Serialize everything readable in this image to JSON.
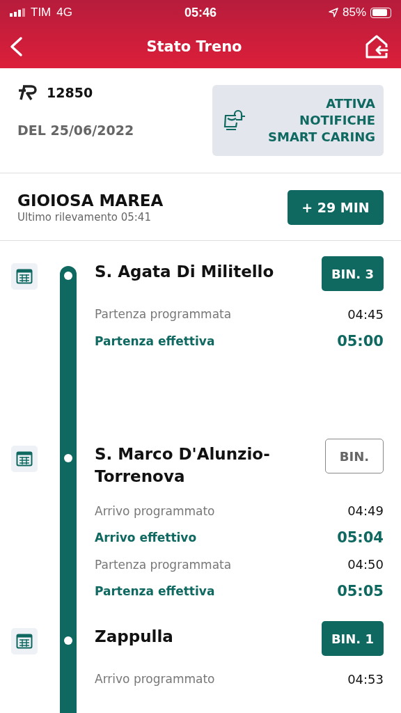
{
  "status_bar": {
    "carrier": "TIM",
    "network": "4G",
    "time": "05:46",
    "battery": "85%"
  },
  "header": {
    "title": "Stato Treno"
  },
  "train": {
    "number": "12850",
    "date": "DEL 25/06/2022",
    "notify_button": "ATTIVA NOTIFICHE SMART CARING"
  },
  "current": {
    "station": "GIOIOSA MAREA",
    "last_update": "Ultimo rilevamento 05:41",
    "delay": "+ 29 MIN"
  },
  "stops": [
    {
      "name": "S. Agata Di Militello",
      "platform": "BIN. 3",
      "platform_assigned": true,
      "times": [
        {
          "kind": "scheduled",
          "label": "Partenza programmata",
          "time": "04:45"
        },
        {
          "kind": "actual",
          "label": "Partenza effettiva",
          "time": "05:00"
        }
      ]
    },
    {
      "name": "S. Marco D'Alunzio-Torrenova",
      "platform": "BIN.",
      "platform_assigned": false,
      "times": [
        {
          "kind": "scheduled",
          "label": "Arrivo programmato",
          "time": "04:49"
        },
        {
          "kind": "actual",
          "label": "Arrivo effettivo",
          "time": "05:04"
        },
        {
          "kind": "scheduled",
          "label": "Partenza programmata",
          "time": "04:50"
        },
        {
          "kind": "actual",
          "label": "Partenza effettiva",
          "time": "05:05"
        }
      ]
    },
    {
      "name": "Zappulla",
      "platform": "BIN. 1",
      "platform_assigned": true,
      "times": [
        {
          "kind": "scheduled",
          "label": "Arrivo programmato",
          "time": "04:53"
        }
      ]
    }
  ]
}
